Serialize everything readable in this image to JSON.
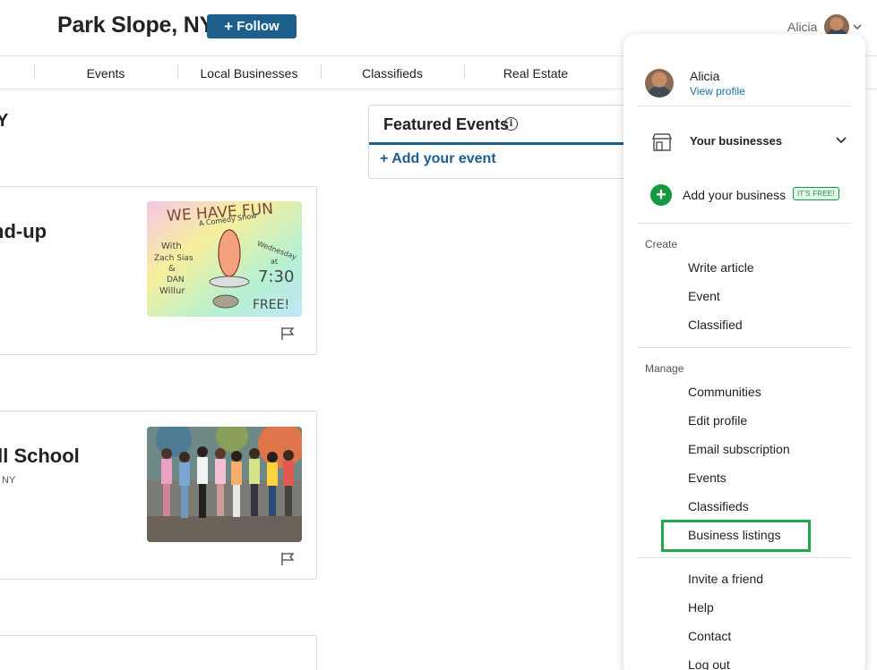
{
  "header": {
    "title": "Park Slope, NY",
    "follow_label": "Follow",
    "user_name": "Alicia"
  },
  "nav": {
    "items": [
      "Events",
      "Local Businesses",
      "Classifieds",
      "Real Estate"
    ]
  },
  "main": {
    "partial_heading": "Y",
    "cards": [
      {
        "title": "nd-up",
        "subtitle": "",
        "image": "comedy-show-poster"
      },
      {
        "title": "ill School",
        "subtitle": "ll, NY",
        "image": "children-group-photo"
      }
    ],
    "poster_text": {
      "line1": "WE HAVE FUN",
      "line2": "A Comedy Show",
      "with": "With",
      "performer1": "Zach Sias",
      "amp": "&",
      "performer2a": "DAN",
      "performer2b": "Willur",
      "when1": "Wednesday",
      "when2": "at",
      "time": "7:30",
      "price": "FREE!"
    }
  },
  "featured": {
    "title": "Featured Events",
    "add_event": "+ Add your event"
  },
  "dropdown": {
    "name": "Alicia",
    "view_profile": "View profile",
    "your_businesses": "Your businesses",
    "add_business": "Add your business",
    "free_badge": "IT'S FREE!",
    "create_label": "Create",
    "create_items": [
      "Write article",
      "Event",
      "Classified"
    ],
    "manage_label": "Manage",
    "manage_items": [
      "Communities",
      "Edit profile",
      "Email subscription",
      "Events",
      "Classifieds",
      "Business listings"
    ],
    "other_items": [
      "Invite a friend",
      "Help",
      "Contact",
      "Log out"
    ]
  },
  "colors": {
    "brand_blue": "#1d5f8d",
    "link_blue": "#1d6fa5",
    "green": "#14993f",
    "highlight_green": "#1fa84a"
  }
}
